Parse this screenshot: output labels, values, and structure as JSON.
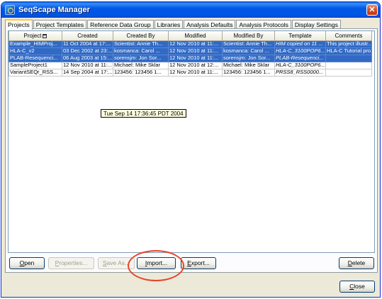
{
  "window": {
    "title": "SeqScape Manager",
    "close_glyph": "✕",
    "icon": "seqscape-app-icon"
  },
  "tabs": [
    {
      "label": "Projects",
      "active": true
    },
    {
      "label": "Project Templates"
    },
    {
      "label": "Reference Data Group"
    },
    {
      "label": "Libraries"
    },
    {
      "label": "Analysis Defaults"
    },
    {
      "label": "Analysis Protocols"
    },
    {
      "label": "Display Settings"
    }
  ],
  "table": {
    "columns": [
      "Project",
      "Created",
      "Created By",
      "Modified",
      "Modified By",
      "Template",
      "Comments"
    ],
    "rows": [
      {
        "selected": true,
        "cells": [
          "Example_HIMProj...",
          "11 Oct 2004 at 17:...",
          "Scientist: Annie Th...",
          "12 Nov 2010 at 11:...",
          "Scientist: Annie Th...",
          "HIM copied on 11 ...",
          "This project illustr..."
        ]
      },
      {
        "selected": true,
        "cells": [
          "HLA-C_v2",
          "03 Dec 2002 at 23:...",
          "kosmanca: Carol ...",
          "12 Nov 2010 at 11:...",
          "kosmanca: Carol ...",
          "HLA-C_3100POP6...",
          "HLA-C Tutorial pro..."
        ]
      },
      {
        "selected": true,
        "cells": [
          "PLAB-Resequenci...",
          "06 Aug 2003 at 15:...",
          "sorensjm: Jon Sor...",
          "12 Nov 2010 at 11:...",
          "sorensjm: Jon Sor...",
          "PLAB-Resequenci...",
          ""
        ]
      },
      {
        "selected": false,
        "cells": [
          "SampleProject1",
          "12 Nov 2010 at 11:...",
          "Michael: Mike Sklar",
          "12 Nov 2010 at 12:...",
          "Michael: Mike Sklar",
          "HLA-C_3100POP6...",
          ""
        ]
      },
      {
        "selected": false,
        "cells": [
          "VariantSEQr_RSS...",
          "14 Sep 2004 at 17:...",
          "123456: 123456 1...",
          "12 Nov 2010 at 11:...",
          "123456: 123456 1...",
          "PRSS8_RSS0000...",
          ""
        ]
      }
    ],
    "tooltip": "Tue Sep 14 17:36:45 PDT 2004"
  },
  "buttons": {
    "open": {
      "pre": "",
      "u": "O",
      "post": "pen"
    },
    "properties": {
      "pre": "",
      "u": "P",
      "post": "roperties..."
    },
    "save_as": {
      "pre": "",
      "u": "S",
      "post": "ave As..."
    },
    "import": {
      "pre": "",
      "u": "I",
      "post": "mport..."
    },
    "export": {
      "pre": "",
      "u": "E",
      "post": "xport..."
    },
    "delete": {
      "pre": "",
      "u": "D",
      "post": "elete"
    },
    "close": {
      "pre": "",
      "u": "C",
      "post": "lose"
    }
  },
  "colors": {
    "selection": "#316ac5",
    "annotation_ring": "#e8442a",
    "titlebar": "#0054e3"
  }
}
